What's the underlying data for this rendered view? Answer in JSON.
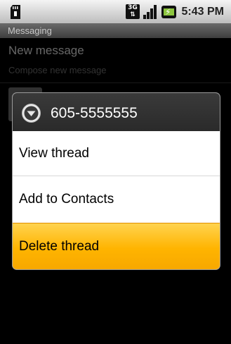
{
  "status_bar": {
    "network": "3G",
    "time": "5:43 PM",
    "icons": [
      "sd-card-icon",
      "3g-icon",
      "signal-icon",
      "battery-charging-icon"
    ]
  },
  "app": {
    "title": "Messaging"
  },
  "background_list": {
    "new_message_title": "New message",
    "new_message_subtitle": "Compose new message"
  },
  "context_menu": {
    "title": "605-5555555",
    "header_icon": "down-arrow-circle-icon",
    "items": [
      {
        "label": "View thread"
      },
      {
        "label": "Add to Contacts"
      },
      {
        "label": "Delete thread",
        "highlighted": true
      }
    ]
  },
  "colors": {
    "highlight": "#ffb400",
    "dialog_header": "#333333"
  }
}
